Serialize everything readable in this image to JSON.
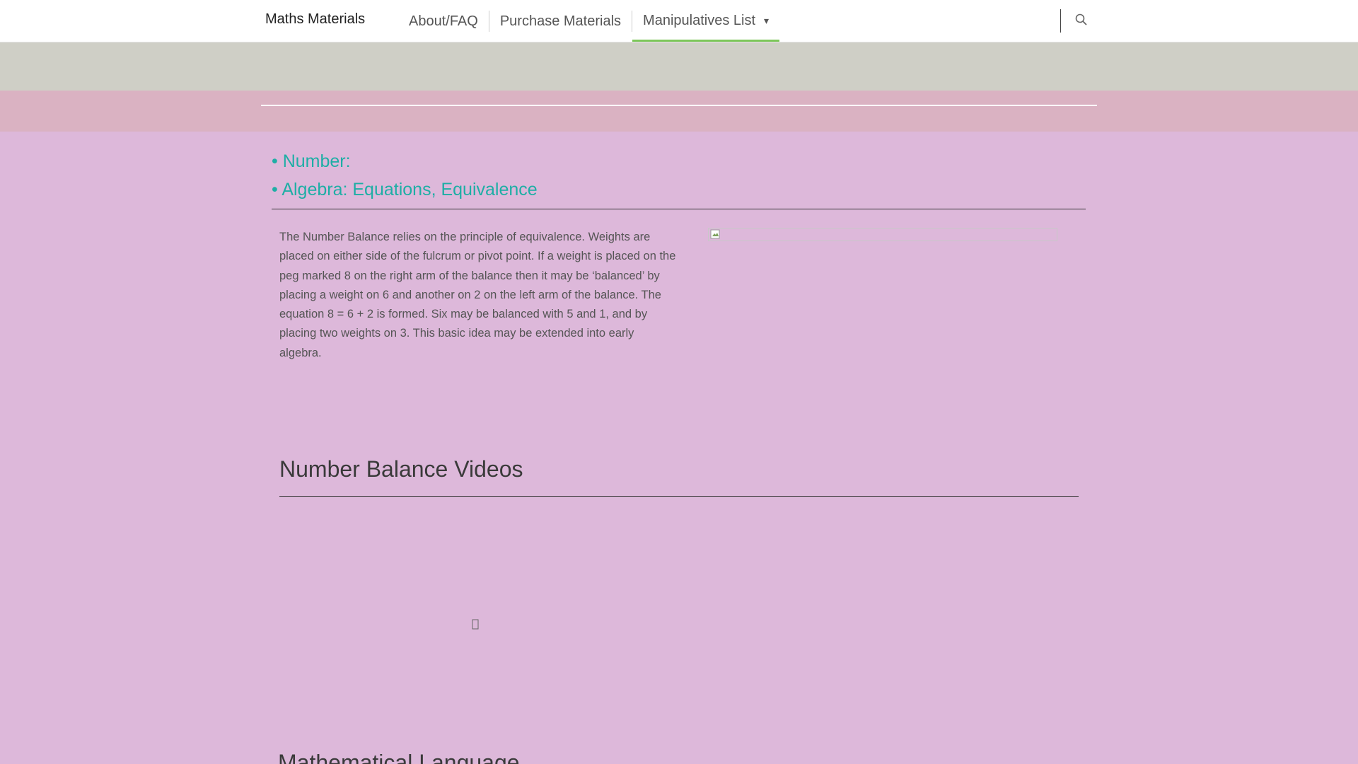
{
  "brand": "Maths Materials",
  "nav": {
    "items": [
      {
        "label": "About/FAQ"
      },
      {
        "label": "Purchase Materials"
      },
      {
        "label": "Manipulatives List",
        "active": true
      }
    ],
    "search_icon": "search-icon",
    "dropdown_icon": "chevron-down-icon"
  },
  "topics": [
    "• Number:",
    "• Algebra: Equations, Equivalence"
  ],
  "description": "The Number Balance relies on the principle of equivalence. Weights are placed on either side of the fulcrum or pivot point. If a weight is placed on the peg marked 8 on the right arm of the balance then it may be ‘balanced’ by placing a weight on 6 and another on 2 on the left arm of the balance. The equation 8 = 6 + 2 is formed. Six may be balanced with 5 and 1, and by placing two weights on 3. This basic idea may be extended into early algebra.",
  "videos_heading": "Number Balance Videos",
  "next_heading": "Mathematical Language",
  "colors": {
    "accent_green": "#7dc65a",
    "topic_teal": "#1eaea5",
    "page_bg": "#ddb8da",
    "band_grey": "#cfcfc6",
    "band_pink": "#dab2c2"
  }
}
